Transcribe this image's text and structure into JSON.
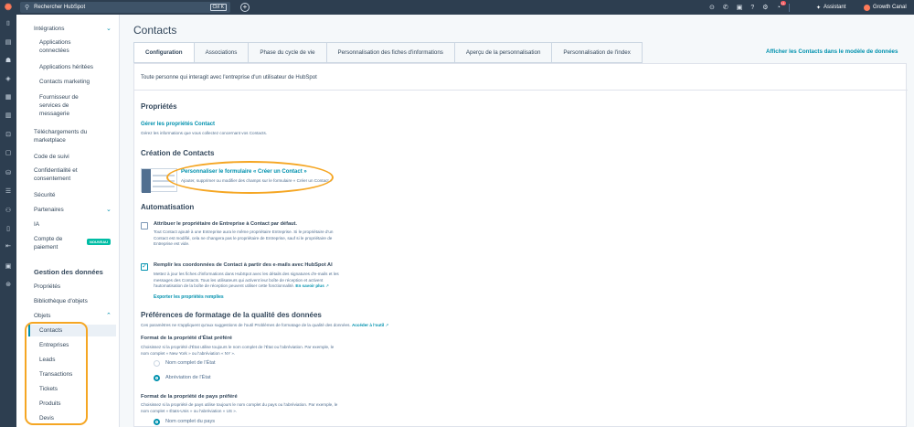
{
  "topbar": {
    "search_placeholder": "Rechercher HubSpot",
    "shortcut": "Ctrl K",
    "notification_count": "11",
    "assistant_label": "Assistant",
    "account_label": "Growth Canal"
  },
  "sidebar": {
    "items": {
      "integrations": "Intégrations",
      "connected_apps": [
        "Applications",
        "connectées"
      ],
      "inherited_apps": "Applications héritées",
      "contacts_marketing": "Contacts marketing",
      "service_provider": [
        "Fournisseur de",
        "services de",
        "messagerie"
      ],
      "marketplace_downloads": [
        "Téléchargements du",
        "marketplace"
      ],
      "tracking_code": "Code de suivi",
      "privacy": [
        "Confidentialité et",
        "consentement"
      ],
      "security": "Sécurité",
      "partners": "Partenaires",
      "ai": "IA",
      "payment_account": [
        "Compte de",
        "paiement"
      ],
      "new_badge": "NOUVEAU",
      "data_management": "Gestion des données",
      "properties": "Propriétés",
      "object_library": "Bibliothèque d'objets",
      "objects": "Objets",
      "contacts": "Contacts",
      "companies": "Entreprises",
      "leads": "Leads",
      "deals": "Transactions",
      "tickets": "Tickets",
      "products": "Produits",
      "quotes": "Devis"
    }
  },
  "main": {
    "title": "Contacts",
    "tabs": [
      "Configuration",
      "Associations",
      "Phase du cycle de vie",
      "Personnalisation des fiches d'informations",
      "Aperçu de la personnalisation",
      "Personnalisation de l'index"
    ],
    "model_link": "Afficher les Contacts dans le modèle de données",
    "intro": "Toute personne qui interagit avec l'entreprise d'un utilisateur de HubSpot",
    "properties": {
      "heading": "Propriétés",
      "link": "Gérer les propriétés Contact",
      "desc": "Gérez les informations que vous collectez concernant vos Contacts."
    },
    "creation": {
      "heading": "Création de Contacts",
      "link": "Personnaliser le formulaire « Créer un Contact »",
      "desc": "Ajouter, supprimer ou modifier des champs sur le formulaire « Créer un Contact »"
    },
    "automation": {
      "heading": "Automatisation",
      "opt1_label": "Attribuer le propriétaire de Entreprise à Contact par défaut.",
      "opt1_desc": [
        "Tout Contact ajouté à une Entreprise aura le même propriétaire Entreprise. Si le propriétaire d'un",
        "Contact est modifié, cela ne changera pas le propriétaire de Entreprise, sauf si le propriétaire de",
        "Entreprise est vide."
      ],
      "opt2_label": "Remplir les coordonnées de Contact à partir des e-mails avec HubSpot AI",
      "opt2_desc": [
        "Mettez à jour les fiches d'informations dans HubSpot avec les détails des signatures d'e-mails et les",
        "messages des Contacts. Tous les utilisateurs qui activent leur boîte de réception et activent",
        "l'automatisation de la boîte de réception peuvent utiliser cette fonctionnalité."
      ],
      "learn_more": "En savoir plus",
      "export_link": "Exporter les propriétés remplies"
    },
    "formatting": {
      "heading": "Préférences de formatage de la qualité des données",
      "desc": "Ces paramètres ne s'appliquent qu'aux suggestions de l'outil Problèmes de formatage de la qualité des données.",
      "tool_link": "Accéder à l'outil",
      "state_heading": "Format de la propriété d'État préféré",
      "state_desc": [
        "Choisissez si la propriété d'État utilise toujours le nom complet de l'État ou l'abréviation. Par exemple, le",
        "nom complet « New York » ou l'abréviation « NY »."
      ],
      "state_opt1": "Nom complet de l'État",
      "state_opt2": "Abréviation de l'État",
      "country_heading": "Format de la propriété de pays préféré",
      "country_desc": [
        "Choisissez si la propriété de pays utilise toujours le nom complet du pays ou l'abréviation. Par exemple, le",
        "nom complet « États-Unis » ou l'abréviation « US »."
      ],
      "country_opt1": "Nom complet du pays"
    }
  }
}
